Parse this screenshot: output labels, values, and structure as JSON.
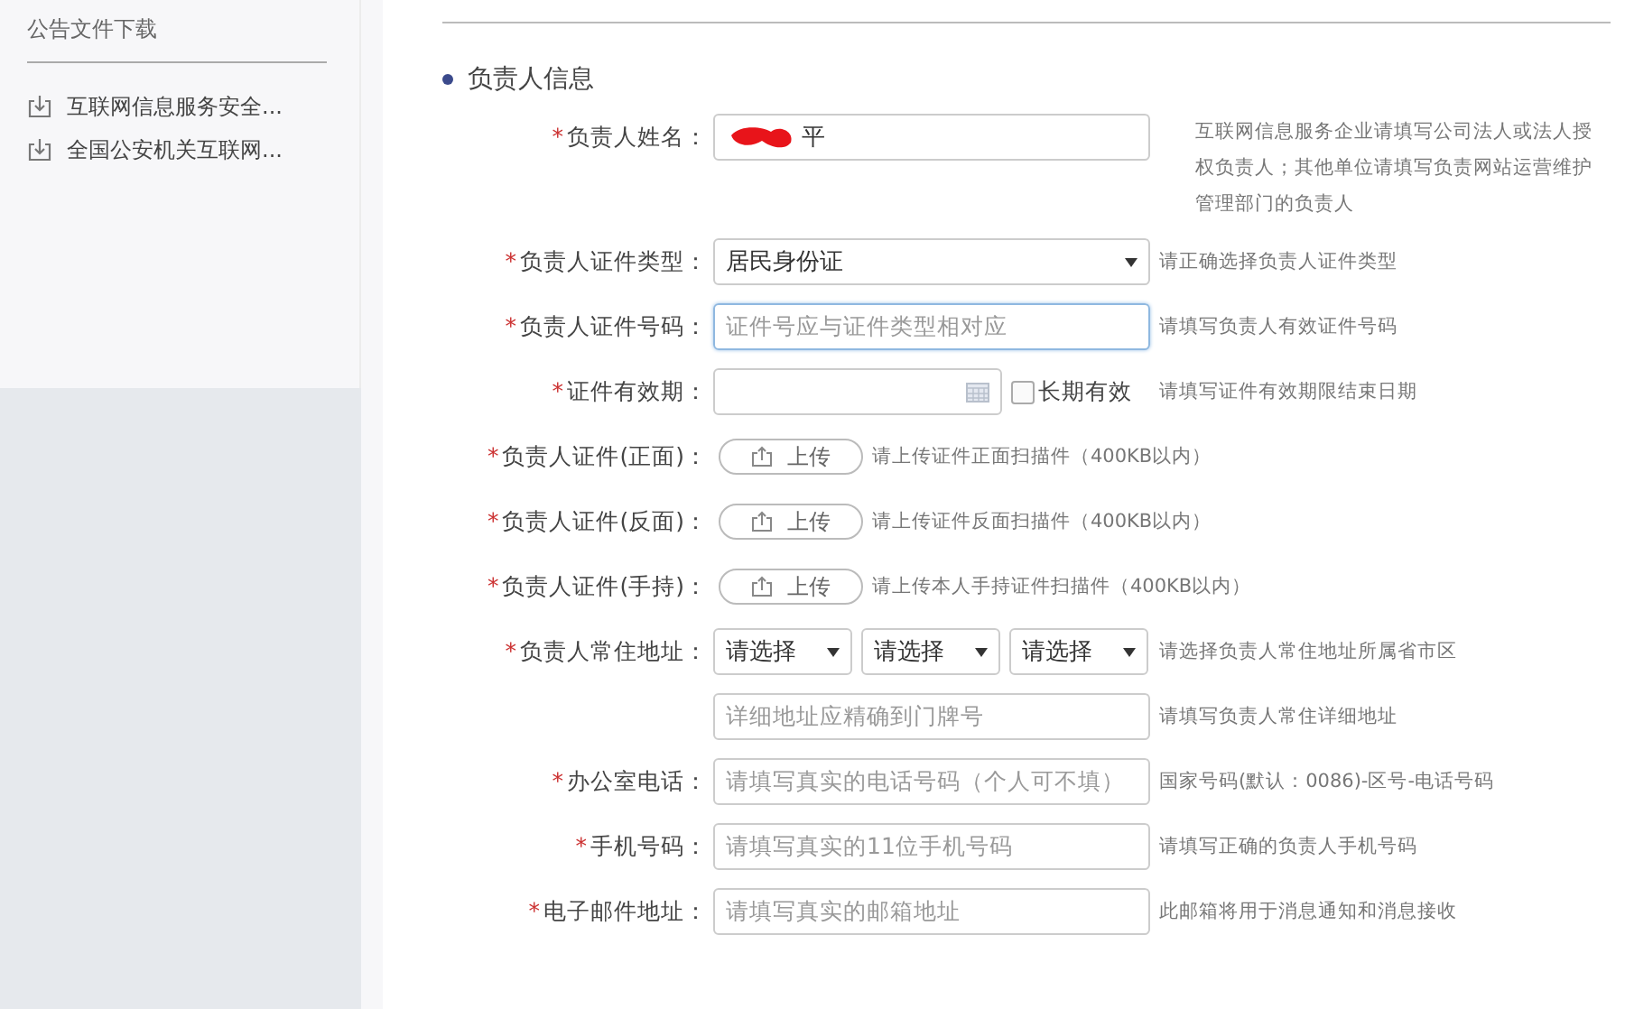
{
  "sidebar": {
    "title": "公告文件下载",
    "items": [
      {
        "label": "互联网信息服务安全..."
      },
      {
        "label": "全国公安机关互联网..."
      }
    ]
  },
  "section": {
    "title": "负责人信息"
  },
  "form_rows": [
    {
      "kind": "text",
      "marker": "*",
      "label": "负责人姓名：",
      "value": "平",
      "redacted": true,
      "hint": "互联网信息服务企业请填写公司法人或法人授权负责人；其他单位请填写负责网站运营维护管理部门的负责人"
    },
    {
      "kind": "select",
      "marker": "*",
      "label": "负责人证件类型：",
      "value": "居民身份证",
      "hint": "请正确选择负责人证件类型"
    },
    {
      "kind": "text",
      "marker": "*",
      "label": "负责人证件号码：",
      "placeholder": "证件号应与证件类型相对应",
      "focused": true,
      "hint": "请填写负责人有效证件号码"
    },
    {
      "kind": "date",
      "marker": "*",
      "label": "证件有效期：",
      "checkbox": {
        "label": "长期有效",
        "checked": false
      },
      "hint": "请填写证件有效期限结束日期"
    },
    {
      "kind": "upload",
      "marker": "*",
      "label": "负责人证件(正面)：",
      "button": "上传",
      "hint": "请上传证件正面扫描件（400KB以内）"
    },
    {
      "kind": "upload",
      "marker": "*",
      "label": "负责人证件(反面)：",
      "button": "上传",
      "hint": "请上传证件反面扫描件（400KB以内）"
    },
    {
      "kind": "upload",
      "marker": "*",
      "label": "负责人证件(手持)：",
      "button": "上传",
      "hint": "请上传本人手持证件扫描件（400KB以内）"
    },
    {
      "kind": "selects",
      "marker": "*",
      "label": "负责人常住地址：",
      "options": [
        "请选择",
        "请选择",
        "请选择"
      ],
      "hint": "请选择负责人常住地址所属省市区"
    },
    {
      "kind": "text",
      "placeholder": "详细地址应精确到门牌号",
      "hint": "请填写负责人常住详细地址"
    },
    {
      "kind": "text",
      "marker": "*",
      "label": "办公室电话：",
      "placeholder": "请填写真实的电话号码（个人可不填）",
      "hint": "国家号码(默认：0086)-区号-电话号码"
    },
    {
      "kind": "text",
      "marker": "*",
      "label": "手机号码：",
      "placeholder": "请填写真实的11位手机号码",
      "hint": "请填写正确的负责人手机号码"
    },
    {
      "kind": "text",
      "marker": "*",
      "label": "电子邮件地址：",
      "placeholder": "请填写真实的邮箱地址",
      "hint": "此邮箱将用于消息通知和消息接收"
    }
  ]
}
